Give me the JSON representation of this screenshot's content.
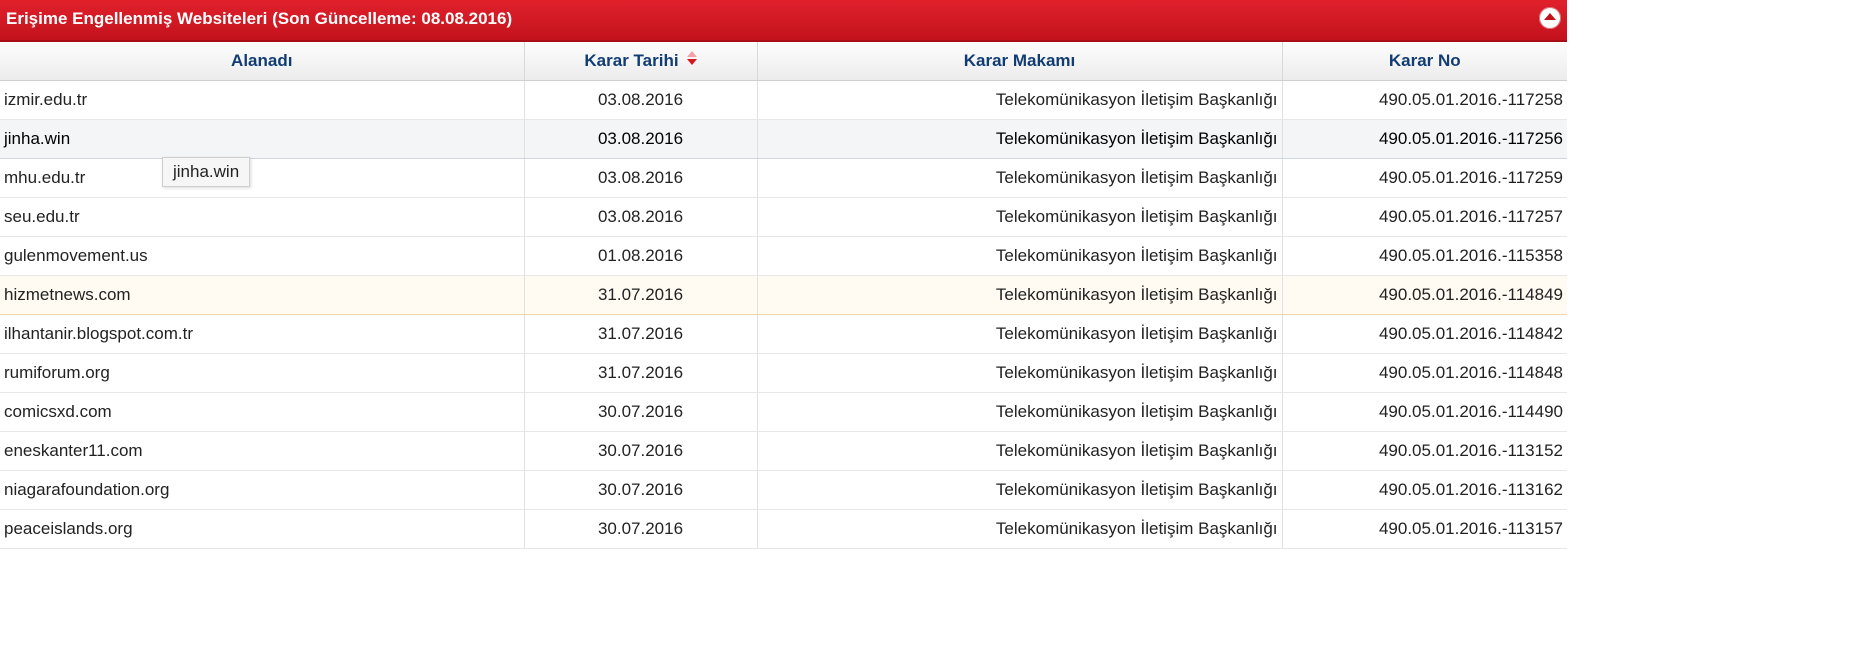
{
  "panel": {
    "title": "Erişime Engellenmiş Websiteleri (Son Güncelleme: 08.08.2016)",
    "collapse_icon": "chevron-up-icon"
  },
  "table": {
    "columns": [
      "Alanadı",
      "Karar Tarihi",
      "Karar Makamı",
      "Karar No"
    ],
    "sort": {
      "column": "Karar Tarihi",
      "direction": "desc"
    },
    "rows": [
      [
        "izmir.edu.tr",
        "03.08.2016",
        "Telekomünikasyon İletişim Başkanlığı",
        "490.05.01.2016.-117258"
      ],
      [
        "jinha.win",
        "03.08.2016",
        "Telekomünikasyon İletişim Başkanlığı",
        "490.05.01.2016.-117256"
      ],
      [
        "mhu.edu.tr",
        "03.08.2016",
        "Telekomünikasyon İletişim Başkanlığı",
        "490.05.01.2016.-117259"
      ],
      [
        "seu.edu.tr",
        "03.08.2016",
        "Telekomünikasyon İletişim Başkanlığı",
        "490.05.01.2016.-117257"
      ],
      [
        "gulenmovement.us",
        "01.08.2016",
        "Telekomünikasyon İletişim Başkanlığı",
        "490.05.01.2016.-115358"
      ],
      [
        "hizmetnews.com",
        "31.07.2016",
        "Telekomünikasyon İletişim Başkanlığı",
        "490.05.01.2016.-114849"
      ],
      [
        "ilhantanir.blogspot.com.tr",
        "31.07.2016",
        "Telekomünikasyon İletişim Başkanlığı",
        "490.05.01.2016.-114842"
      ],
      [
        "rumiforum.org",
        "31.07.2016",
        "Telekomünikasyon İletişim Başkanlığı",
        "490.05.01.2016.-114848"
      ],
      [
        "comicsxd.com",
        "30.07.2016",
        "Telekomünikasyon İletişim Başkanlığı",
        "490.05.01.2016.-114490"
      ],
      [
        "eneskanter11.com",
        "30.07.2016",
        "Telekomünikasyon İletişim Başkanlığı",
        "490.05.01.2016.-113152"
      ],
      [
        "niagarafoundation.org",
        "30.07.2016",
        "Telekomünikasyon İletişim Başkanlığı",
        "490.05.01.2016.-113162"
      ],
      [
        "peaceislands.org",
        "30.07.2016",
        "Telekomünikasyon İletişim Başkanlığı",
        "490.05.01.2016.-113157"
      ]
    ],
    "hover_row": 1,
    "highlight_row": 5
  },
  "tooltip": {
    "text": "jinha.win"
  },
  "colors": {
    "header_red": "#d8141f",
    "column_header_text": "#123d74"
  }
}
